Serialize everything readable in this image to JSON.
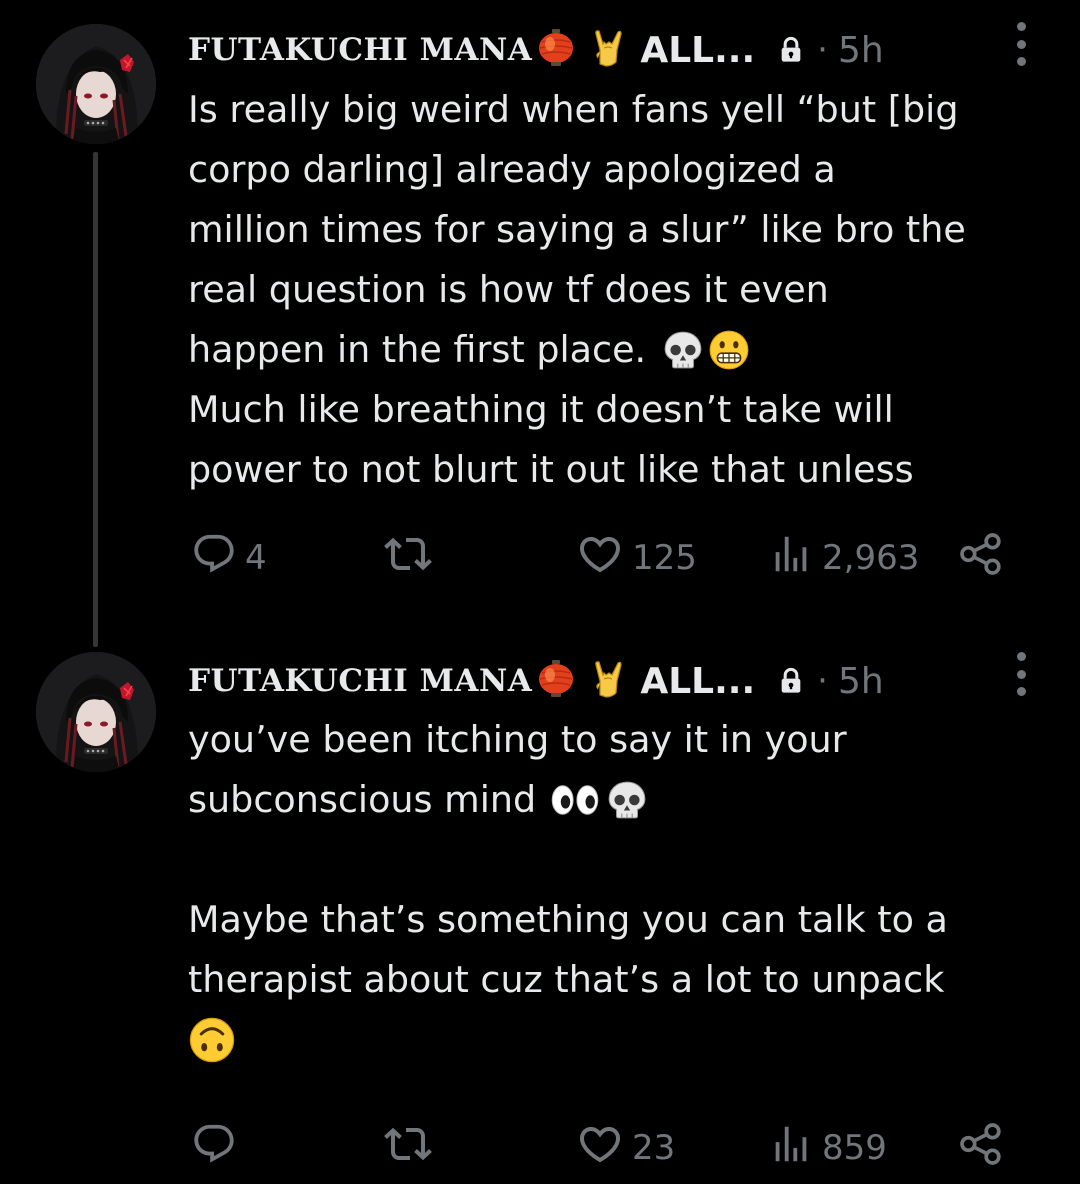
{
  "tweets": [
    {
      "author": "FUTAKUCHI MANA",
      "name_tail": "ALL...",
      "dot": "·",
      "time": "5h",
      "body_lines": [
        "Is really big weird when fans yell “but [big",
        "corpo darling] already apologized a",
        "million times for saying a slur” like bro the",
        "real question is how tf does it even",
        "happen in the first place.",
        "Much like breathing it doesn’t take will",
        "power to not blurt it out like that unless"
      ],
      "icons": [
        "lantern-emoji",
        "rock-hand-emoji",
        "lock-icon",
        "skull-emoji",
        "grimace-emoji"
      ],
      "stats": {
        "replies": "4",
        "reposts": "",
        "likes": "125",
        "views": "2,963"
      }
    },
    {
      "author": "FUTAKUCHI MANA",
      "name_tail": "ALL...",
      "dot": "·",
      "time": "5h",
      "body_lines": [
        "you’ve been itching to say it in your",
        "subconscious mind",
        "",
        "Maybe that’s something you can talk to a",
        "therapist about cuz that’s a lot to unpack"
      ],
      "icons": [
        "lantern-emoji",
        "rock-hand-emoji",
        "lock-icon",
        "eyes-emoji",
        "skull-emoji",
        "upside-down-face-emoji"
      ],
      "stats": {
        "replies": "",
        "reposts": "",
        "likes": "23",
        "views": "859"
      }
    }
  ],
  "colors": {
    "background": "#000000",
    "text": "#e7e9ea",
    "muted": "#71767b",
    "thread_line": "#333639"
  }
}
